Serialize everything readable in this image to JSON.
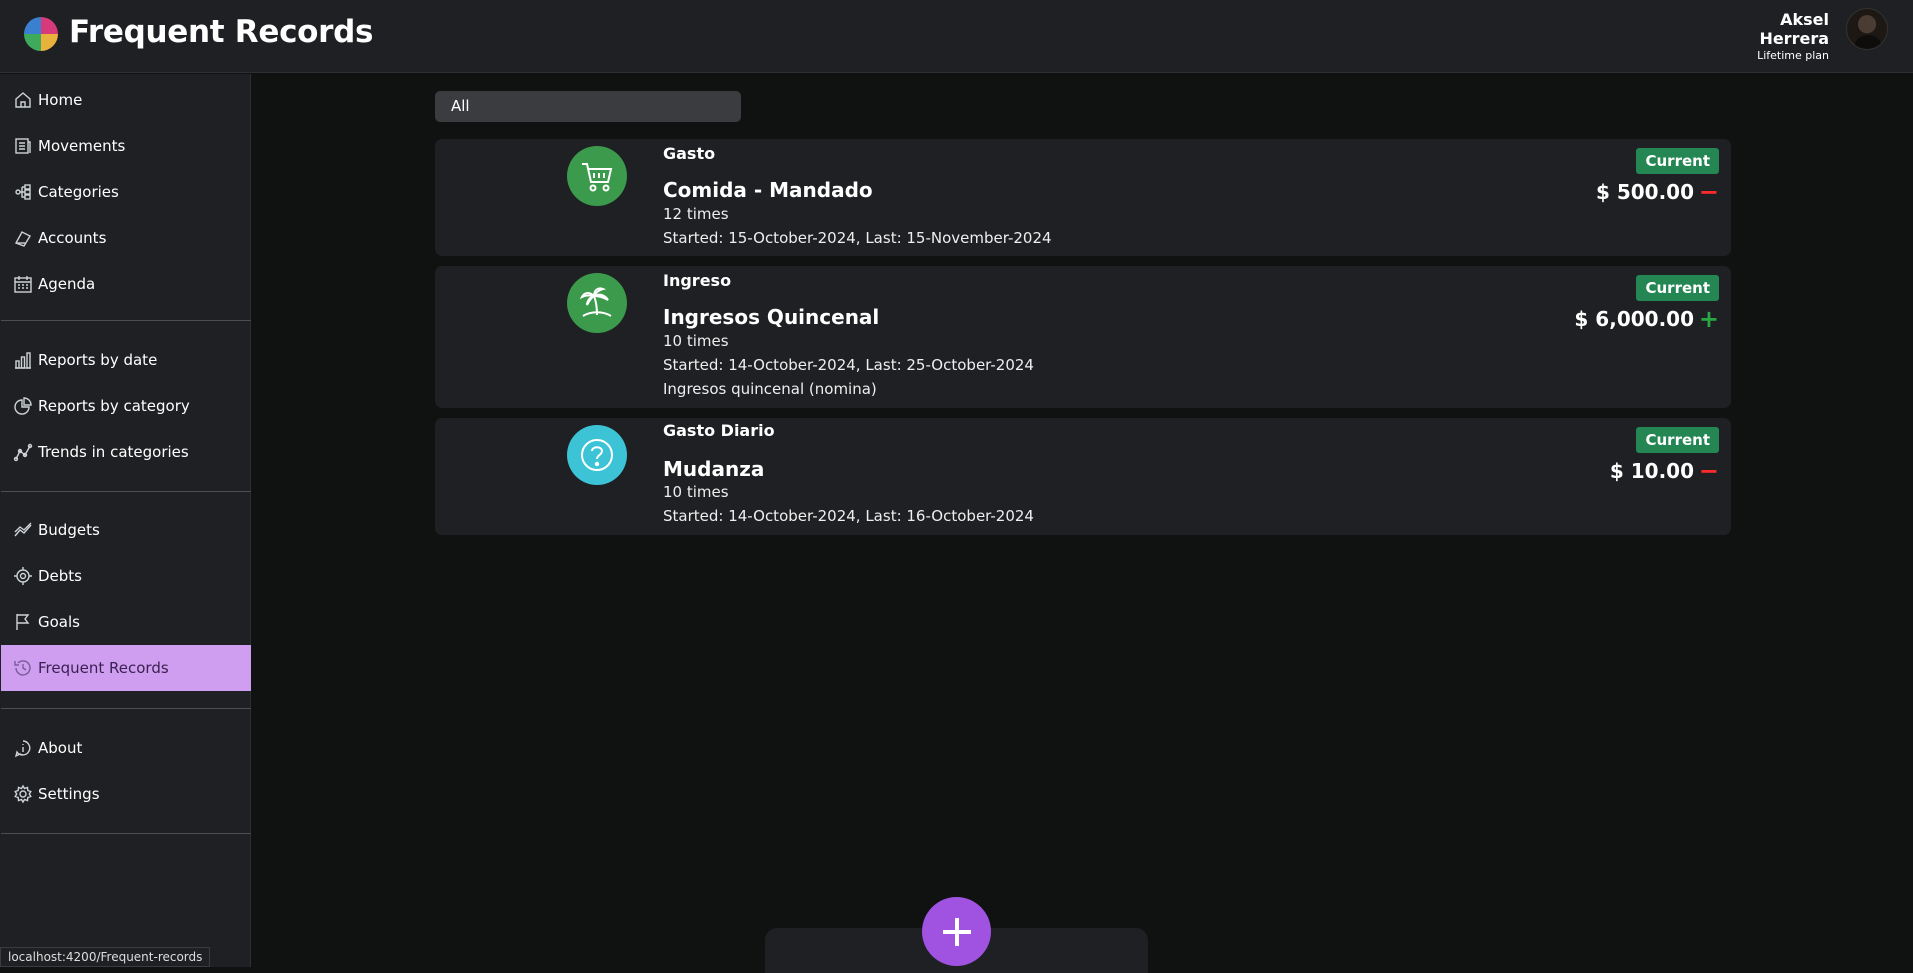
{
  "header": {
    "title": "Frequent Records",
    "user_first": "Aksel",
    "user_last": "Herrera",
    "plan": "Lifetime plan"
  },
  "sidebar": {
    "groups": [
      [
        {
          "label": "Home",
          "icon": "home-icon"
        },
        {
          "label": "Movements",
          "icon": "movements-icon"
        },
        {
          "label": "Categories",
          "icon": "categories-icon"
        },
        {
          "label": "Accounts",
          "icon": "accounts-icon"
        },
        {
          "label": "Agenda",
          "icon": "calendar-icon"
        }
      ],
      [
        {
          "label": "Reports by date",
          "icon": "bar-chart-icon"
        },
        {
          "label": "Reports by category",
          "icon": "pie-chart-icon"
        },
        {
          "label": "Trends in categories",
          "icon": "trend-icon"
        }
      ],
      [
        {
          "label": "Budgets",
          "icon": "budget-icon"
        },
        {
          "label": "Debts",
          "icon": "debt-icon"
        },
        {
          "label": "Goals",
          "icon": "flag-icon"
        },
        {
          "label": "Frequent Records",
          "icon": "history-icon",
          "active": true
        }
      ],
      [
        {
          "label": "About",
          "icon": "info-icon"
        },
        {
          "label": "Settings",
          "icon": "gear-icon"
        }
      ]
    ]
  },
  "filter": {
    "value": "All"
  },
  "records": [
    {
      "type": "Gasto",
      "name": "Comida - Mandado",
      "times": "12 times",
      "dates": "Started: 15-October-2024, Last: 15-November-2024",
      "note": "",
      "status": "Current",
      "amount": "$ 500.00",
      "direction": "expense",
      "icon": "shopping-cart-icon",
      "icon_color": "#3c9a4c"
    },
    {
      "type": "Ingreso",
      "name": "Ingresos Quincenal",
      "times": "10 times",
      "dates": "Started: 14-October-2024, Last: 25-October-2024",
      "note": "Ingresos quincenal (nomina)",
      "status": "Current",
      "amount": "$ 6,000.00",
      "direction": "income",
      "icon": "palm-tree-icon",
      "icon_color": "#3c9a4c"
    },
    {
      "type": "Gasto Diario",
      "name": "Mudanza",
      "times": "10 times",
      "dates": "Started: 14-October-2024, Last: 16-October-2024",
      "note": "",
      "status": "Current",
      "amount": "$ 10.00",
      "direction": "expense",
      "icon": "question-icon",
      "icon_color": "#3cc3d6"
    }
  ],
  "status_bar": {
    "url": "localhost:4200/Frequent-records"
  }
}
